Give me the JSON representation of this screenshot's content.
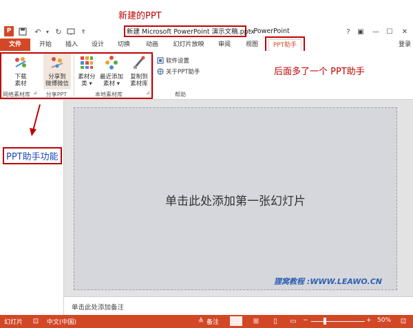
{
  "annotations": {
    "new_ppt": "新建的PPT",
    "extra_tab": "后面多了一个 PPT助手",
    "features": "PPT助手功能"
  },
  "titlebar": {
    "doc_title": "新建 Microsoft PowerPoint 演示文稿.pptx",
    "app_suffix": "- PowerPoint",
    "help": "?",
    "controls": [
      "?",
      "▣",
      "—",
      "☐",
      "✕"
    ]
  },
  "tabs": {
    "file": "文件",
    "items": [
      "开始",
      "插入",
      "设计",
      "切换",
      "动画",
      "幻灯片放映",
      "审阅",
      "视图"
    ],
    "active": "PPT助手",
    "login": "登录"
  },
  "ribbon": {
    "download": "下载\n素材",
    "download_l1": "下载",
    "download_l2": "素材",
    "share_l1": "分享到",
    "share_l2": "微博微信",
    "category_l1": "素材分",
    "category_l2": "类 ▾",
    "recent_l1": "最近添加",
    "recent_l2": "素材 ▾",
    "copy_l1": "复制到",
    "copy_l2": "素材库",
    "settings": "软件设置",
    "about": "关于PPT助手",
    "groups": {
      "online": "网络素材库",
      "share": "分享PPT",
      "local": "本地素材库",
      "help": "帮助"
    }
  },
  "slide": {
    "placeholder": "单击此处添加第一张幻灯片",
    "watermark": "狸窝教程 :WWW.LEAWO.CN",
    "notes": "单击此处添加备注"
  },
  "status": {
    "slide": "幻灯片",
    "language": "中文(中国)",
    "notes": "备注",
    "zoom": "50%",
    "zoom_minus": "−",
    "zoom_plus": "+"
  },
  "colors": {
    "accent": "#d24726",
    "annotation": "#c00000",
    "annotation_blue": "#1f49b8"
  }
}
